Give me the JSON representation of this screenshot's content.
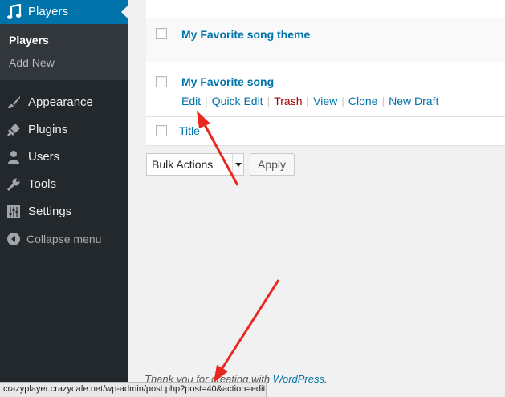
{
  "sidebar": {
    "active_menu": "Players",
    "submenu": {
      "current": "Players",
      "other": "Add New"
    },
    "items": [
      {
        "label": "Appearance",
        "icon": "paintbrush-icon"
      },
      {
        "label": "Plugins",
        "icon": "plug-icon"
      },
      {
        "label": "Users",
        "icon": "user-icon"
      },
      {
        "label": "Tools",
        "icon": "wrench-icon"
      },
      {
        "label": "Settings",
        "icon": "sliders-icon"
      }
    ],
    "collapse_label": "Collapse menu",
    "active_icon": "music-note-icon"
  },
  "posts": {
    "rows": [
      {
        "title": "My Favorite song theme"
      },
      {
        "title": "My Favorite song"
      }
    ],
    "row_actions": {
      "edit": "Edit",
      "quick_edit": "Quick Edit",
      "trash": "Trash",
      "view": "View",
      "clone": "Clone",
      "new_draft": "New Draft",
      "separator": "|"
    },
    "column_title": "Title"
  },
  "bulk": {
    "selected": "Bulk Actions",
    "apply_label": "Apply"
  },
  "footer": {
    "text": "Thank you for creating with ",
    "link": "WordPress",
    "end": "."
  },
  "status_url": "crazyplayer.crazycafe.net/wp-admin/post.php?post=40&action=edit",
  "colors": {
    "sidebar_bg": "#23282d",
    "active_bg": "#0073aa",
    "link": "#0073aa",
    "trash": "#a00",
    "arrow": "#e8281e"
  }
}
